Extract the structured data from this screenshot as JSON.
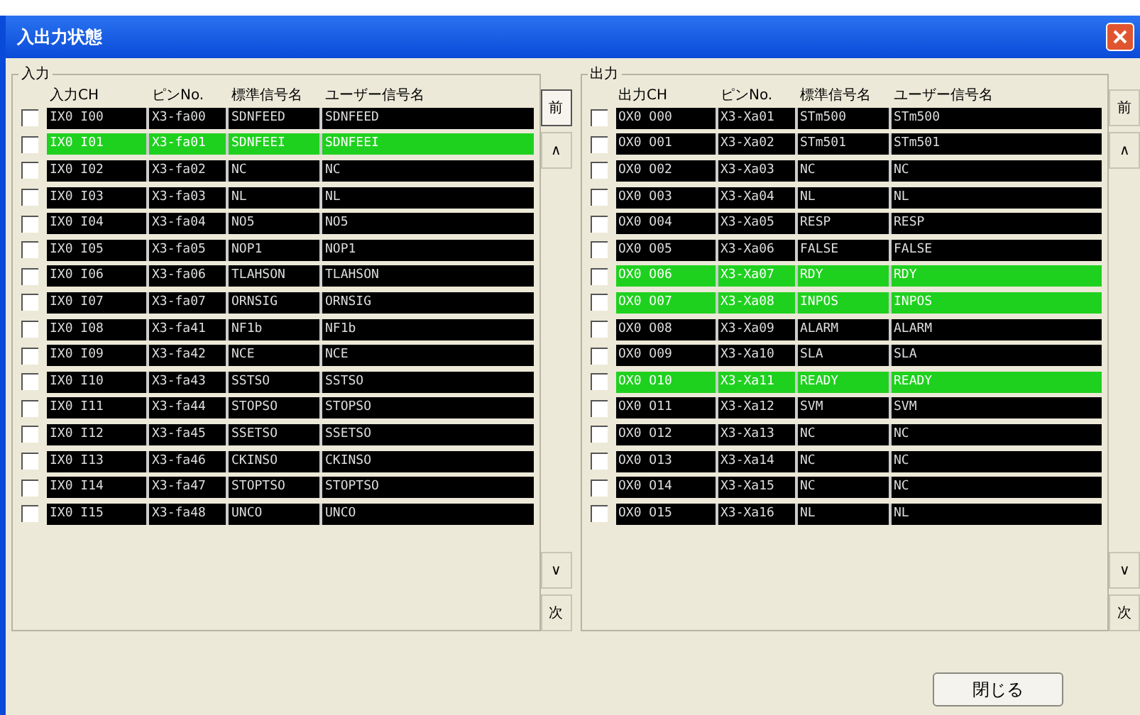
{
  "window": {
    "title": "入出力状態"
  },
  "panels": [
    {
      "label": "入力",
      "columns": [
        "入力CH",
        "ピンNo.",
        "標準信号名",
        "ユーザー信号名"
      ],
      "nav": [
        {
          "label": "前",
          "pressed": true
        },
        {
          "label": "∧",
          "pressed": false
        },
        {
          "label": "∨",
          "pressed": false
        },
        {
          "label": "次",
          "pressed": false
        }
      ],
      "rows": [
        {
          "checked": false,
          "on": false,
          "cells": [
            "IX0 I00",
            "X3-fa00",
            "SDNFEED",
            "SDNFEED"
          ]
        },
        {
          "checked": false,
          "on": true,
          "cells": [
            "IX0 I01",
            "X3-fa01",
            "SDNFEEI",
            "SDNFEEI"
          ]
        },
        {
          "checked": false,
          "on": false,
          "cells": [
            "IX0 I02",
            "X3-fa02",
            "NC",
            "NC"
          ]
        },
        {
          "checked": false,
          "on": false,
          "cells": [
            "IX0 I03",
            "X3-fa03",
            "NL",
            "NL"
          ]
        },
        {
          "checked": false,
          "on": false,
          "cells": [
            "IX0 I04",
            "X3-fa04",
            "NO5",
            "NO5"
          ]
        },
        {
          "checked": false,
          "on": false,
          "cells": [
            "IX0 I05",
            "X3-fa05",
            "NOP1",
            "NOP1"
          ]
        },
        {
          "checked": false,
          "on": false,
          "cells": [
            "IX0 I06",
            "X3-fa06",
            "TLAHSON",
            "TLAHSON"
          ]
        },
        {
          "checked": false,
          "on": false,
          "cells": [
            "IX0 I07",
            "X3-fa07",
            "ORNSIG",
            "ORNSIG"
          ]
        },
        {
          "checked": false,
          "on": false,
          "cells": [
            "IX0 I08",
            "X3-fa41",
            "NF1b",
            "NF1b"
          ]
        },
        {
          "checked": false,
          "on": false,
          "cells": [
            "IX0 I09",
            "X3-fa42",
            "NCE",
            "NCE"
          ]
        },
        {
          "checked": false,
          "on": false,
          "cells": [
            "IX0 I10",
            "X3-fa43",
            "SSTSO",
            "SSTSO"
          ]
        },
        {
          "checked": false,
          "on": false,
          "cells": [
            "IX0 I11",
            "X3-fa44",
            "STOPSO",
            "STOPSO"
          ]
        },
        {
          "checked": false,
          "on": false,
          "cells": [
            "IX0 I12",
            "X3-fa45",
            "SSETSO",
            "SSETSO"
          ]
        },
        {
          "checked": false,
          "on": false,
          "cells": [
            "IX0 I13",
            "X3-fa46",
            "CKINSO",
            "CKINSO"
          ]
        },
        {
          "checked": false,
          "on": false,
          "cells": [
            "IX0 I14",
            "X3-fa47",
            "STOPTSO",
            "STOPTSO"
          ]
        },
        {
          "checked": false,
          "on": false,
          "cells": [
            "IX0 I15",
            "X3-fa48",
            "UNCO",
            "UNCO"
          ]
        }
      ]
    },
    {
      "label": "出力",
      "columns": [
        "出力CH",
        "ピンNo.",
        "標準信号名",
        "ユーザー信号名"
      ],
      "nav": [
        {
          "label": "前",
          "pressed": false
        },
        {
          "label": "∧",
          "pressed": false
        },
        {
          "label": "∨",
          "pressed": false
        },
        {
          "label": "次",
          "pressed": false
        }
      ],
      "rows": [
        {
          "checked": false,
          "on": false,
          "cells": [
            "OX0 O00",
            "X3-Xa01",
            "STm500",
            "STm500"
          ]
        },
        {
          "checked": false,
          "on": false,
          "cells": [
            "OX0 O01",
            "X3-Xa02",
            "STm501",
            "STm501"
          ]
        },
        {
          "checked": false,
          "on": false,
          "cells": [
            "OX0 O02",
            "X3-Xa03",
            "NC",
            "NC"
          ]
        },
        {
          "checked": false,
          "on": false,
          "cells": [
            "OX0 O03",
            "X3-Xa04",
            "NL",
            "NL"
          ]
        },
        {
          "checked": false,
          "on": false,
          "cells": [
            "OX0 O04",
            "X3-Xa05",
            "RESP",
            "RESP"
          ]
        },
        {
          "checked": false,
          "on": false,
          "cells": [
            "OX0 O05",
            "X3-Xa06",
            "FALSE",
            "FALSE"
          ]
        },
        {
          "checked": false,
          "on": true,
          "cells": [
            "OX0 O06",
            "X3-Xa07",
            "RDY",
            "RDY"
          ]
        },
        {
          "checked": false,
          "on": true,
          "cells": [
            "OX0 O07",
            "X3-Xa08",
            "INPOS",
            "INPOS"
          ]
        },
        {
          "checked": false,
          "on": false,
          "cells": [
            "OX0 O08",
            "X3-Xa09",
            "ALARM",
            "ALARM"
          ]
        },
        {
          "checked": false,
          "on": false,
          "cells": [
            "OX0 O09",
            "X3-Xa10",
            "SLA",
            "SLA"
          ]
        },
        {
          "checked": false,
          "on": true,
          "cells": [
            "OX0 O10",
            "X3-Xa11",
            "READY",
            "READY"
          ]
        },
        {
          "checked": false,
          "on": false,
          "cells": [
            "OX0 O11",
            "X3-Xa12",
            "SVM",
            "SVM"
          ]
        },
        {
          "checked": false,
          "on": false,
          "cells": [
            "OX0 O12",
            "X3-Xa13",
            "NC",
            "NC"
          ]
        },
        {
          "checked": false,
          "on": false,
          "cells": [
            "OX0 O13",
            "X3-Xa14",
            "NC",
            "NC"
          ]
        },
        {
          "checked": false,
          "on": false,
          "cells": [
            "OX0 O14",
            "X3-Xa15",
            "NC",
            "NC"
          ]
        },
        {
          "checked": false,
          "on": false,
          "cells": [
            "OX0 O15",
            "X3-Xa16",
            "NL",
            "NL"
          ]
        }
      ]
    }
  ],
  "close_button": "閉じる"
}
